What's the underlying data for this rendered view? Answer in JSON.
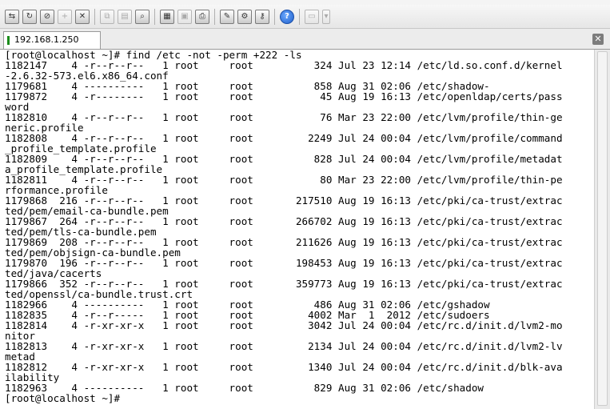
{
  "tab": {
    "label": "192.168.1.250"
  },
  "toolbar": {
    "icons": [
      "connect-icon",
      "reconnect-icon",
      "disconnect-icon",
      "new-session-icon",
      "close-session-icon",
      "copy-icon",
      "paste-icon",
      "find-icon",
      "print-setup-icon",
      "print-icon",
      "print-screen-icon",
      "options-icon",
      "keymap-icon",
      "key-icon",
      "help-icon",
      "display-icon",
      "dropdown-icon"
    ]
  },
  "terminal": {
    "lines": [
      "[root@localhost ~]# find /etc -not -perm +222 -ls",
      "1182147    4 -r--r--r--   1 root     root          324 Jul 23 12:14 /etc/ld.so.conf.d/kernel",
      "-2.6.32-573.el6.x86_64.conf",
      "1179681    4 ----------   1 root     root          858 Aug 31 02:06 /etc/shadow-",
      "1179872    4 -r--------   1 root     root           45 Aug 19 16:13 /etc/openldap/certs/pass",
      "word",
      "1182810    4 -r--r--r--   1 root     root           76 Mar 23 22:00 /etc/lvm/profile/thin-ge",
      "neric.profile",
      "1182808    4 -r--r--r--   1 root     root         2249 Jul 24 00:04 /etc/lvm/profile/command",
      "_profile_template.profile",
      "1182809    4 -r--r--r--   1 root     root          828 Jul 24 00:04 /etc/lvm/profile/metadat",
      "a_profile_template.profile",
      "1182811    4 -r--r--r--   1 root     root           80 Mar 23 22:00 /etc/lvm/profile/thin-pe",
      "rformance.profile",
      "1179868  216 -r--r--r--   1 root     root       217510 Aug 19 16:13 /etc/pki/ca-trust/extrac",
      "ted/pem/email-ca-bundle.pem",
      "1179867  264 -r--r--r--   1 root     root       266702 Aug 19 16:13 /etc/pki/ca-trust/extrac",
      "ted/pem/tls-ca-bundle.pem",
      "1179869  208 -r--r--r--   1 root     root       211626 Aug 19 16:13 /etc/pki/ca-trust/extrac",
      "ted/pem/objsign-ca-bundle.pem",
      "1179870  196 -r--r--r--   1 root     root       198453 Aug 19 16:13 /etc/pki/ca-trust/extrac",
      "ted/java/cacerts",
      "1179866  352 -r--r--r--   1 root     root       359773 Aug 19 16:13 /etc/pki/ca-trust/extrac",
      "ted/openssl/ca-bundle.trust.crt",
      "1182966    4 ----------   1 root     root          486 Aug 31 02:06 /etc/gshadow",
      "1182835    4 -r--r-----   1 root     root         4002 Mar  1  2012 /etc/sudoers",
      "1182814    4 -r-xr-xr-x   1 root     root         3042 Jul 24 00:04 /etc/rc.d/init.d/lvm2-mo",
      "nitor",
      "1182813    4 -r-xr-xr-x   1 root     root         2134 Jul 24 00:04 /etc/rc.d/init.d/lvm2-lv",
      "metad",
      "1182812    4 -r-xr-xr-x   1 root     root         1340 Jul 24 00:04 /etc/rc.d/init.d/blk-ava",
      "ilability",
      "1182963    4 ----------   1 root     root          829 Aug 31 02:06 /etc/shadow",
      "[root@localhost ~]# "
    ]
  }
}
